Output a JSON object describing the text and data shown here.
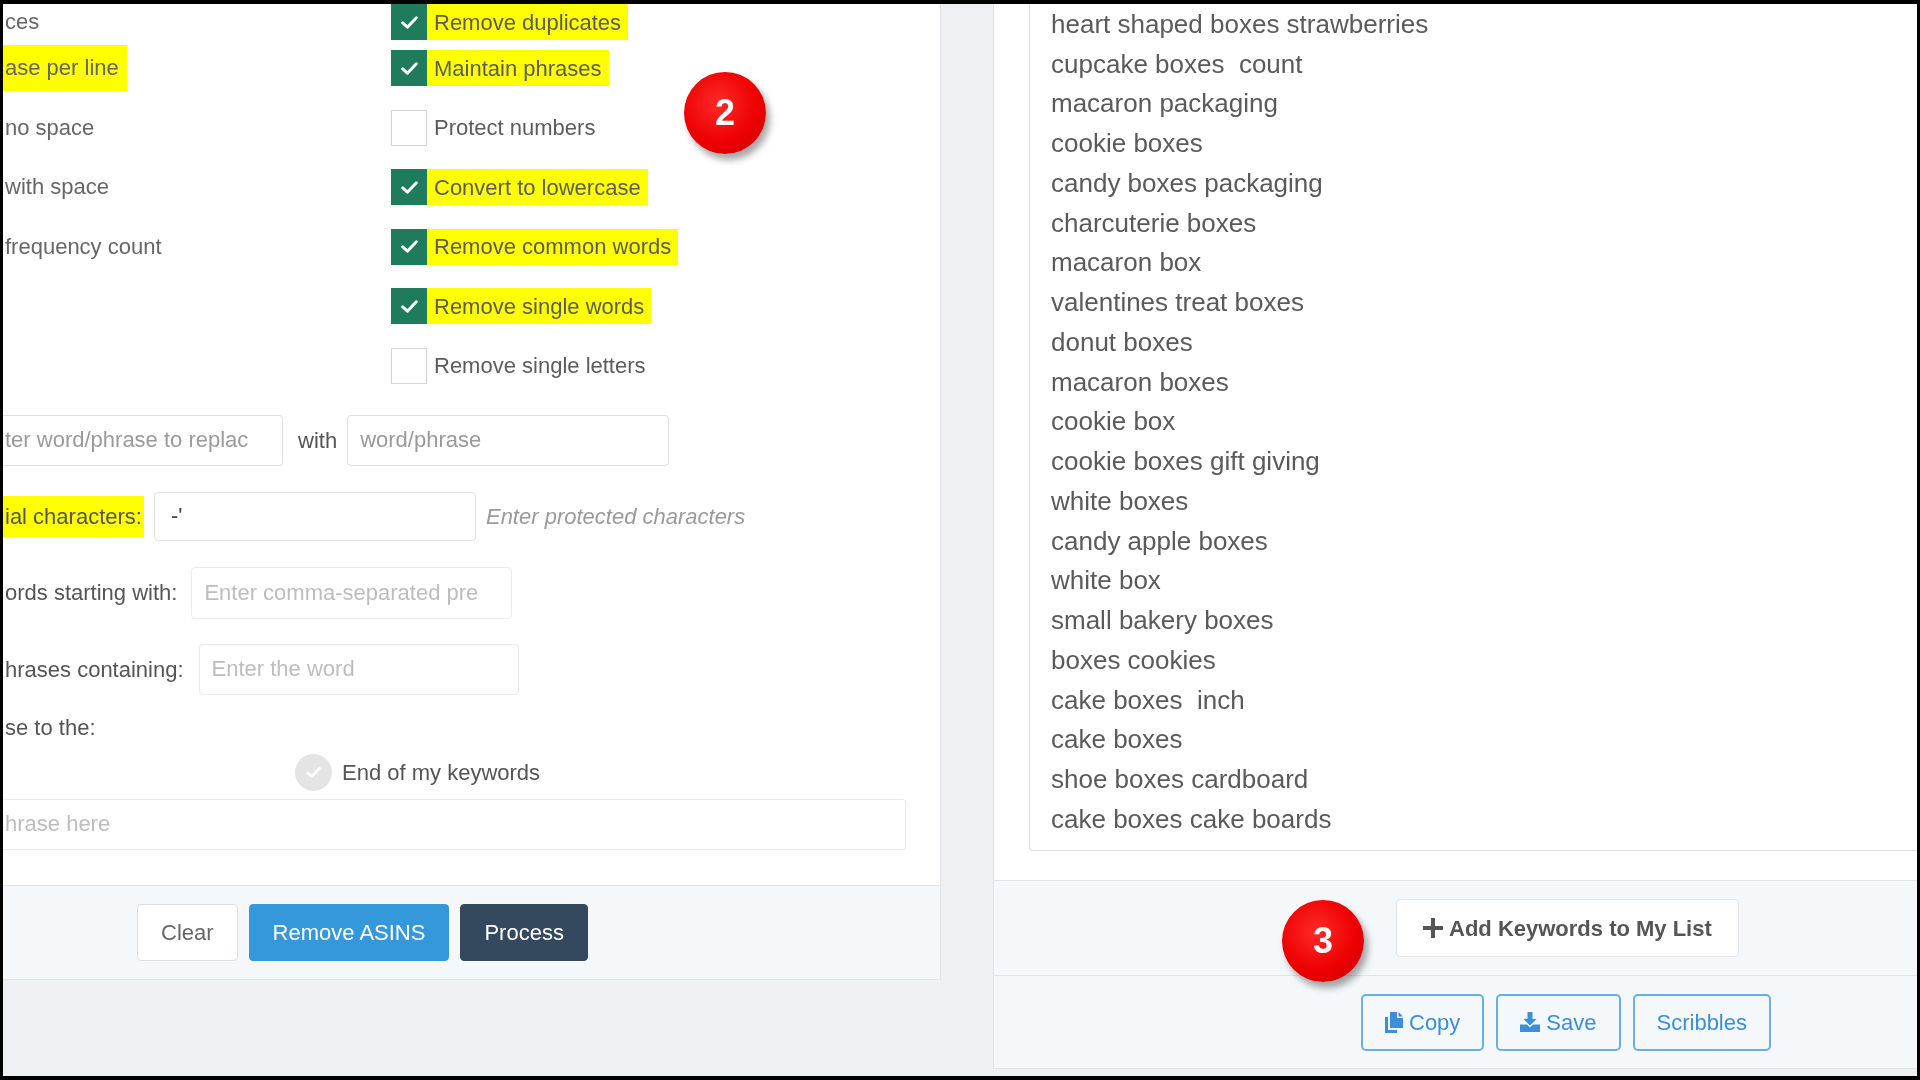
{
  "left_panel": {
    "output_options": [
      {
        "label": "ces",
        "highlighted": false
      },
      {
        "label": "ase per line",
        "highlighted": true
      },
      {
        "label": "no space",
        "highlighted": false
      },
      {
        "label": "with space",
        "highlighted": false
      },
      {
        "label": "frequency count",
        "highlighted": false
      }
    ],
    "cleaning_options": [
      {
        "label": "Remove duplicates",
        "checked": true,
        "highlighted": true
      },
      {
        "label": "Maintain phrases",
        "checked": true,
        "highlighted": true
      },
      {
        "label": "Protect numbers",
        "checked": false,
        "highlighted": false
      },
      {
        "label": "Convert to lowercase",
        "checked": true,
        "highlighted": true
      },
      {
        "label": "Remove common words",
        "checked": true,
        "highlighted": true
      },
      {
        "label": "Remove single words",
        "checked": true,
        "highlighted": true
      },
      {
        "label": "Remove single letters",
        "checked": false,
        "highlighted": false
      }
    ],
    "replace": {
      "find": {
        "placeholder": "ter word/phrase to replac"
      },
      "with_label": "with",
      "replacement": {
        "placeholder": "word/phrase"
      }
    },
    "protected_characters": {
      "label": "ial characters:",
      "highlighted": true,
      "value": "-'",
      "hint": "Enter protected characters"
    },
    "remove_starting_with": {
      "label": "ords starting with:",
      "placeholder": "Enter comma-separated pre"
    },
    "remove_containing": {
      "label": "hrases containing:",
      "placeholder": "Enter the word"
    },
    "add_phrase": {
      "label": "se to the:",
      "radio": {
        "label": "End of my keywords",
        "selected": false
      },
      "input": {
        "placeholder": "hrase here"
      }
    },
    "buttons": [
      {
        "label": "Clear",
        "kind": "default"
      },
      {
        "label": "Remove ASINS",
        "kind": "primary"
      },
      {
        "label": "Process",
        "kind": "dark"
      }
    ],
    "step_badge": "2"
  },
  "right_panel": {
    "keywords": [
      "heart shaped boxes strawberries",
      "cupcake boxes  count",
      "macaron packaging",
      "cookie boxes",
      "candy boxes packaging",
      "charcuterie boxes",
      "macaron box",
      "valentines treat boxes",
      "donut boxes",
      "macaron boxes",
      "cookie box",
      "cookie boxes gift giving",
      "white boxes",
      "candy apple boxes",
      "white box",
      "small bakery boxes",
      "boxes cookies",
      "cake boxes  inch",
      "cake boxes",
      "shoe boxes cardboard",
      "cake boxes cake boards"
    ],
    "add_button": {
      "label": "Add Keywords to My List"
    },
    "step_badge": "3",
    "actions": [
      {
        "label": "Copy",
        "kind": "copy"
      },
      {
        "label": "Save",
        "kind": "save"
      },
      {
        "label": "Scribbles",
        "kind": "text"
      }
    ]
  }
}
